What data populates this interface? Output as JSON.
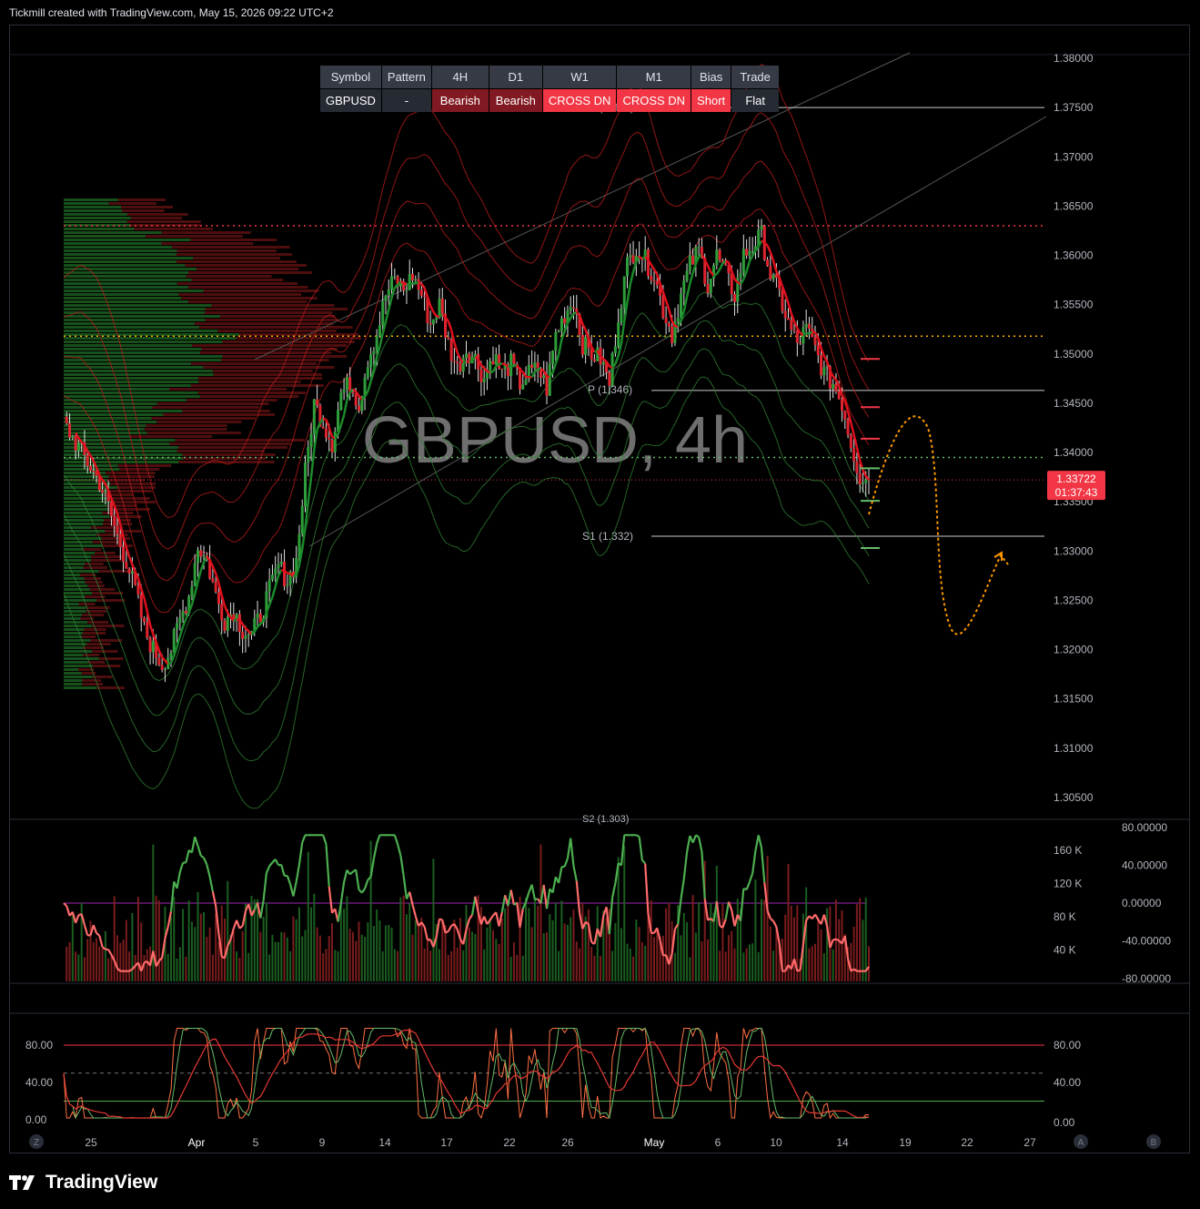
{
  "header": {
    "text": "Tickmill created with TradingView.com, May 15, 2026 09:22 UTC+2"
  },
  "footer": {
    "brand": "TradingView"
  },
  "watermark": {
    "text": "GBPUSD, 4h"
  },
  "signal_table": {
    "headers": [
      "Symbol",
      "Pattern",
      "4H",
      "D1",
      "W1",
      "M1",
      "Bias",
      "Trade"
    ],
    "row": [
      "GBPUSD",
      "-",
      "Bearish",
      "Bearish",
      "CROSS DN",
      "CROSS DN",
      "Short",
      "Flat"
    ],
    "row_styles": [
      "neutral",
      "neutral",
      "bear",
      "bear",
      "short",
      "short",
      "short",
      "neutral"
    ]
  },
  "colors": {
    "bull": "#26a69a",
    "bear": "#f23645",
    "green_band": "#2e7d32",
    "red_band": "#b71c1c",
    "orange": "#ff9800",
    "price_tag": "#f23645",
    "rsi_bull": "#4caf50",
    "rsi_bear": "#ff6b6b"
  },
  "price_tag": {
    "price": "1.33722",
    "countdown": "01:37:43"
  },
  "pivot_labels": {
    "p": "P (1.346)",
    "s1": "S1 (1.332)",
    "s2": "S2 (1.303)",
    "r1": "R1 (1.375)"
  },
  "chart_data": [
    {
      "type": "candlestick",
      "title": "GBPUSD, 4h",
      "ylim": [
        1.3025,
        1.3805
      ],
      "y_ticks": [
        "1.38000",
        "1.37500",
        "1.37000",
        "1.36500",
        "1.36000",
        "1.35500",
        "1.35000",
        "1.34500",
        "1.34000",
        "1.33500",
        "1.33000",
        "1.32500",
        "1.32000",
        "1.31500",
        "1.31000",
        "1.30500"
      ],
      "x_ticks": [
        "25",
        "Apr",
        "5",
        "9",
        "14",
        "17",
        "22",
        "26",
        "May",
        "6",
        "10",
        "14",
        "19",
        "22",
        "27"
      ],
      "levels": {
        "pivot_P": 1.3463,
        "S1": 1.3315,
        "R1": 1.375,
        "red_dotted": 1.363,
        "yellow_dotted": 1.3518,
        "green_dotted": 1.3395,
        "current": 1.33722
      },
      "close_path": [
        1.343,
        1.3415,
        1.34,
        1.3385,
        1.337,
        1.3345,
        1.3315,
        1.329,
        1.326,
        1.322,
        1.32,
        1.3185,
        1.32,
        1.323,
        1.3255,
        1.3305,
        1.329,
        1.3255,
        1.323,
        1.324,
        1.322,
        1.3215,
        1.3235,
        1.326,
        1.3285,
        1.327,
        1.329,
        1.338,
        1.345,
        1.343,
        1.341,
        1.346,
        1.347,
        1.345,
        1.3495,
        1.352,
        1.356,
        1.3575,
        1.3565,
        1.358,
        1.356,
        1.353,
        1.355,
        1.351,
        1.3485,
        1.3505,
        1.3495,
        1.3475,
        1.35,
        1.348,
        1.349,
        1.347,
        1.348,
        1.3485,
        1.3465,
        1.352,
        1.354,
        1.3555,
        1.351,
        1.35,
        1.3495,
        1.347,
        1.354,
        1.359,
        1.361,
        1.3595,
        1.358,
        1.3545,
        1.352,
        1.356,
        1.359,
        1.3605,
        1.357,
        1.36,
        1.358,
        1.356,
        1.36,
        1.361,
        1.362,
        1.358,
        1.356,
        1.353,
        1.351,
        1.3525,
        1.3505,
        1.348,
        1.347,
        1.345,
        1.341,
        1.3375,
        1.33722
      ]
    },
    {
      "type": "line",
      "title": "",
      "ylim": [
        -80,
        80
      ],
      "y_ticks": [
        "80.00000",
        "40.00000",
        "0.00000",
        "-40.00000",
        "-80.00000"
      ],
      "volume_ticks": [
        "160 K",
        "120 K",
        "80 K",
        "40 K"
      ],
      "zero_line": 0
    },
    {
      "type": "line",
      "title": "",
      "ylim": [
        0,
        100
      ],
      "y_ticks": [
        "80.00",
        "40.00",
        "0.00"
      ],
      "levels": {
        "upper": 80,
        "middle": 50,
        "lower": 20
      }
    }
  ],
  "bottom_buttons": {
    "left": "Z",
    "mid": "A",
    "right": "B"
  }
}
